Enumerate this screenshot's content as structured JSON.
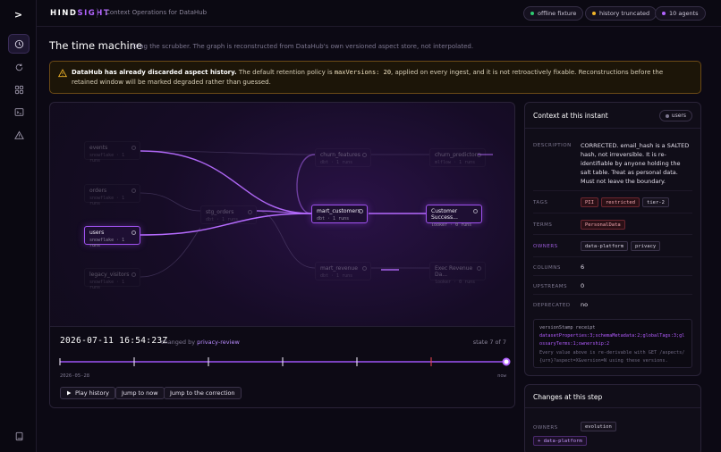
{
  "header": {
    "brand_a": "HIND",
    "brand_b": "SIGHT",
    "subtitle": "Context Operations for DataHub",
    "pills": [
      {
        "label": "offline fixture",
        "dot": "#2ecc71"
      },
      {
        "label": "history truncated",
        "dot": "#f0b429"
      },
      {
        "label": "10 agents",
        "dot": "#b264ff"
      }
    ]
  },
  "page": {
    "title": "The time machine",
    "subtitle": "Drag the scrubber. The graph is reconstructed from DataHub's own versioned aspect store, not interpolated."
  },
  "warning": {
    "bold": "DataHub has already discarded aspect history.",
    "text1": " The default retention policy is ",
    "code": "maxVersions: 20",
    "text2": ", applied on every ingest, and it is not retroactively fixable. Reconstructions before the retained window will be marked degraded rather than guessed."
  },
  "graph": {
    "nodes": [
      {
        "name": "events",
        "meta": "snowflake · 1 runs"
      },
      {
        "name": "orders",
        "meta": "snowflake · 1 runs"
      },
      {
        "name": "users",
        "meta": "snowflake · 1 runs"
      },
      {
        "name": "legacy_visitors",
        "meta": "snowflake · 1 runs"
      },
      {
        "name": "stg_orders",
        "meta": "dbt · 1 runs"
      },
      {
        "name": "churn_features",
        "meta": "dbt · 1 runs"
      },
      {
        "name": "mart_customers",
        "meta": "dbt · 1 runs"
      },
      {
        "name": "mart_revenue",
        "meta": "dbt · 1 runs"
      },
      {
        "name": "churn_predictor",
        "meta": "mlflow · 1 runs"
      },
      {
        "name": "Customer Success...",
        "meta": "looker · 0 runs"
      },
      {
        "name": "Exec Revenue Da...",
        "meta": "looker · 0 runs"
      }
    ]
  },
  "timeline": {
    "timestamp": "2026-07-11 16:54:23Z",
    "changed_prefix": "changed by",
    "changed_by": "privacy-review",
    "state": "state 7 of 7",
    "progress": 1.0,
    "start_label": "2026-05-28",
    "end_label": "now",
    "buttons": {
      "play": "Play history",
      "now": "Jump to now",
      "correction": "Jump to the correction"
    }
  },
  "context": {
    "title": "Context at this instant",
    "entity": "users",
    "labels": {
      "description": "DESCRIPTION",
      "tags": "TAGS",
      "terms": "TERMS",
      "owners": "OWNERS",
      "columns": "COLUMNS",
      "upstreams": "UPSTREAMS",
      "deprecated": "DEPRECATED"
    },
    "description": "CORRECTED. email_hash is a SALTED hash, not irreversible. It is re-identifiable by anyone holding the salt table. Treat as personal data. Must not leave the boundary.",
    "tags": [
      "PII",
      "restricted",
      "tier-2"
    ],
    "terms": [
      "PersonalData"
    ],
    "owners": [
      "data-platform",
      "privacy"
    ],
    "columns": "6",
    "upstreams": "0",
    "deprecated": "no",
    "receipt": {
      "title": "versionStamp receipt",
      "stamp": "datasetProperties:3;schemaMetadata:2;globalTags:3;glossaryTerms:1;ownership:2",
      "note": "Every value above is re-derivable with GET /aspects/{urn}?aspect=X&version=N using these versions."
    }
  },
  "changes": {
    "title": "Changes at this step",
    "label": "OWNERS",
    "removed": "evolution",
    "added": "+ data-platform"
  },
  "colors": {
    "accent": "#b264ff",
    "warning": "#f0b429",
    "danger": "#e0414f"
  }
}
